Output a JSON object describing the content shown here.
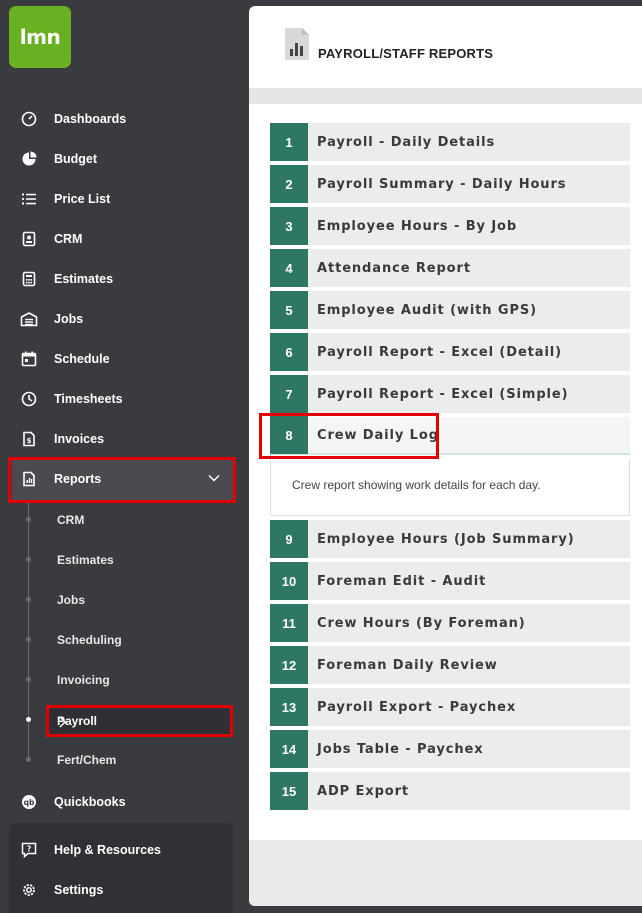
{
  "app": {
    "logo_text": "lmn"
  },
  "sidebar": {
    "items": [
      {
        "label": "Dashboards",
        "icon": "gauge-icon"
      },
      {
        "label": "Budget",
        "icon": "pie-chart-icon"
      },
      {
        "label": "Price List",
        "icon": "list-icon"
      },
      {
        "label": "CRM",
        "icon": "contact-card-icon"
      },
      {
        "label": "Estimates",
        "icon": "calculator-icon"
      },
      {
        "label": "Jobs",
        "icon": "garage-icon"
      },
      {
        "label": "Schedule",
        "icon": "calendar-icon"
      },
      {
        "label": "Timesheets",
        "icon": "clock-icon"
      },
      {
        "label": "Invoices",
        "icon": "invoice-icon"
      },
      {
        "label": "Reports",
        "icon": "report-icon"
      }
    ],
    "sub_items": [
      {
        "label": "CRM"
      },
      {
        "label": "Estimates"
      },
      {
        "label": "Jobs"
      },
      {
        "label": "Scheduling"
      },
      {
        "label": "Invoicing"
      },
      {
        "label": "Payroll"
      },
      {
        "label": "Fert/Chem"
      }
    ],
    "quickbooks": {
      "label": "Quickbooks",
      "icon": "quickbooks-icon"
    },
    "help": {
      "label": "Help & Resources",
      "icon": "help-icon"
    },
    "settings": {
      "label": "Settings",
      "icon": "gear-icon"
    }
  },
  "main": {
    "title": "PAYROLL/STAFF REPORTS",
    "reports": [
      {
        "num": "1",
        "label": "Payroll - Daily Details"
      },
      {
        "num": "2",
        "label": "Payroll Summary - Daily Hours"
      },
      {
        "num": "3",
        "label": "Employee Hours - By Job"
      },
      {
        "num": "4",
        "label": "Attendance Report"
      },
      {
        "num": "5",
        "label": "Employee Audit (with GPS)"
      },
      {
        "num": "6",
        "label": "Payroll Report - Excel (Detail)"
      },
      {
        "num": "7",
        "label": "Payroll Report - Excel (Simple)"
      },
      {
        "num": "8",
        "label": "Crew Daily Log",
        "description": "Crew report showing work details for each day."
      },
      {
        "num": "9",
        "label": "Employee Hours (Job Summary)"
      },
      {
        "num": "10",
        "label": "Foreman Edit - Audit"
      },
      {
        "num": "11",
        "label": "Crew Hours (By Foreman)"
      },
      {
        "num": "12",
        "label": "Foreman Daily Review"
      },
      {
        "num": "13",
        "label": "Payroll Export - Paychex"
      },
      {
        "num": "14",
        "label": "Jobs Table - Paychex"
      },
      {
        "num": "15",
        "label": "ADP Export"
      }
    ]
  },
  "colors": {
    "accent_green": "#2e7764",
    "logo_green": "#6ab023",
    "highlight_red": "#e30000",
    "sidebar_bg": "#3a3b3e"
  }
}
